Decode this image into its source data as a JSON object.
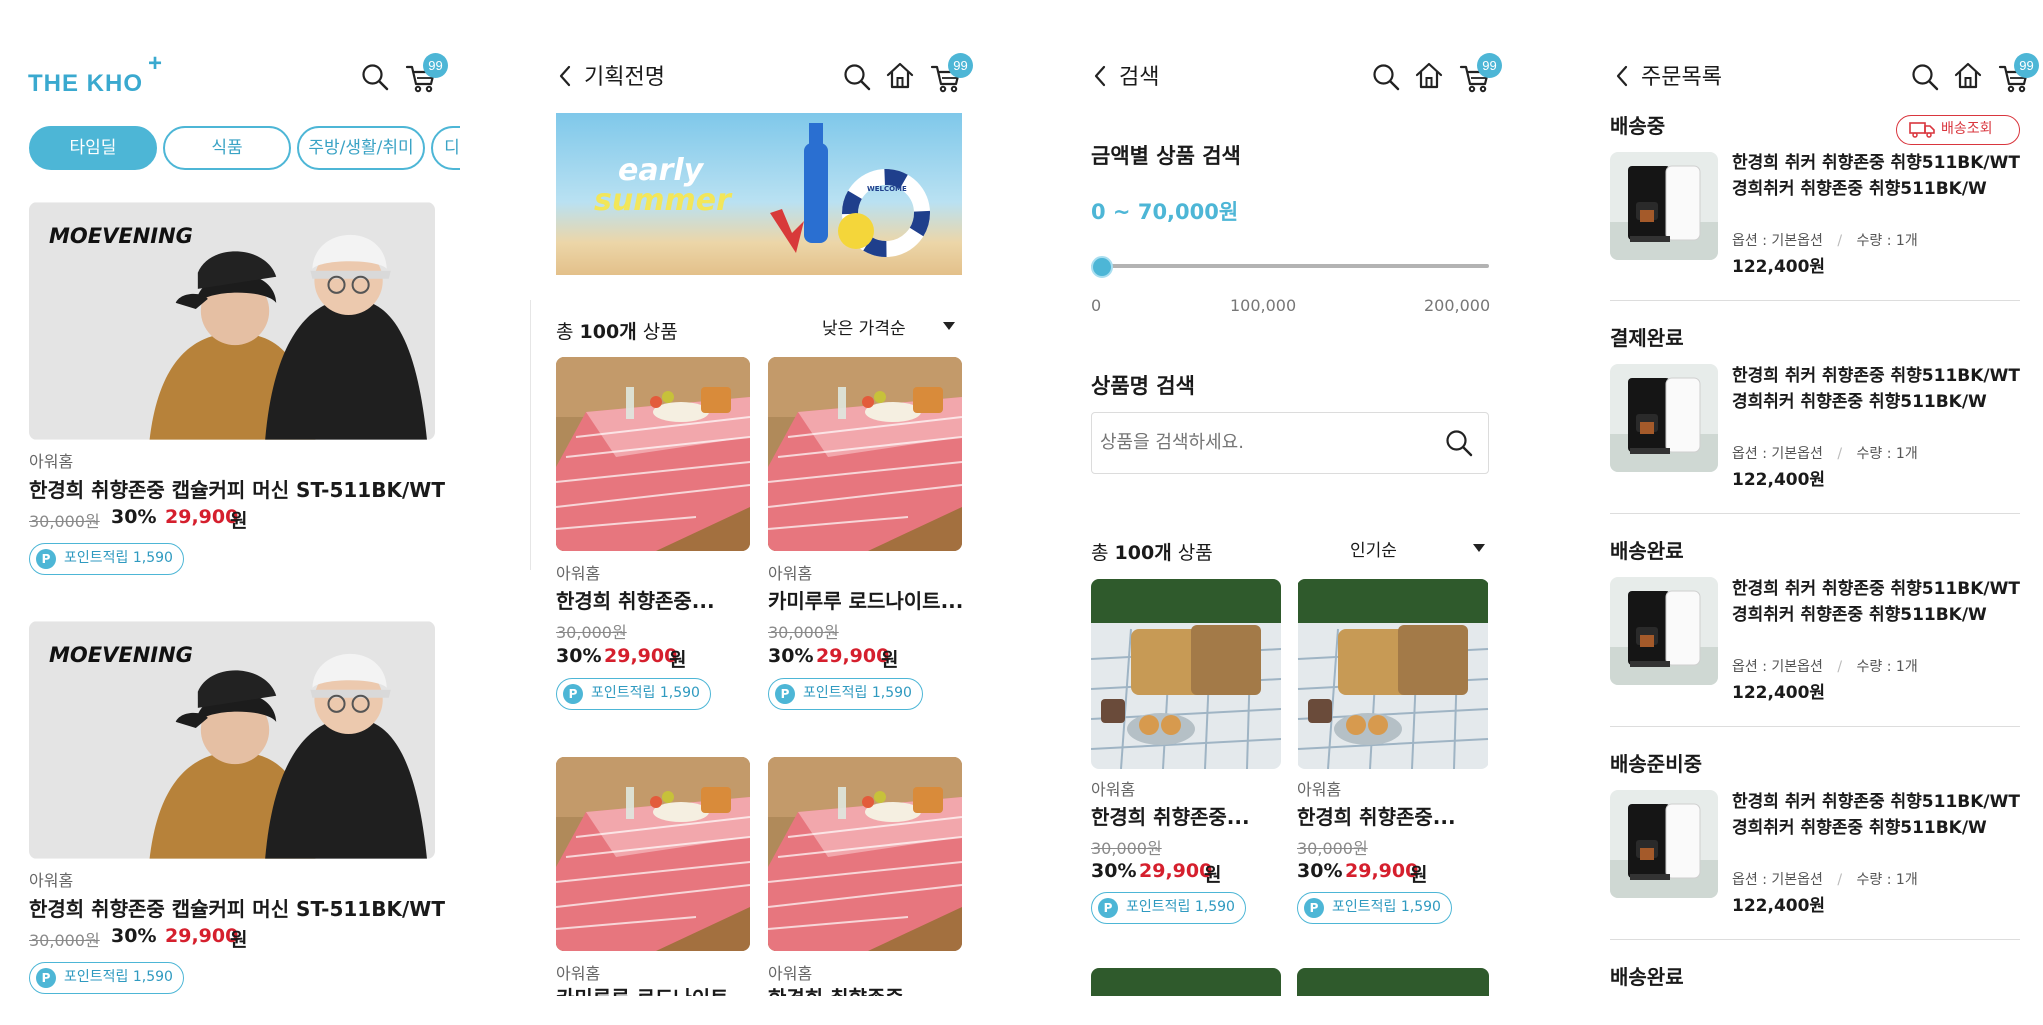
{
  "screen1": {
    "logo_text": "THE KHO",
    "logo_plus": "+",
    "cart_count": "99",
    "chips": [
      "타임딜",
      "식품",
      "주방/생활/취미",
      "디"
    ],
    "products": [
      {
        "banner_brand": "MOEVENING",
        "brand": "아워홈",
        "name": "한경희 취향존중 캡슐커피 머신 ST-511BK/WT",
        "original_price": "30,000원",
        "discount": "30%",
        "price": "29,900",
        "won": "원",
        "points": "포인트적립 1,590"
      },
      {
        "banner_brand": "MOEVENING",
        "brand": "아워홈",
        "name": "한경희 취향존중 캡슐커피 머신 ST-511BK/WT",
        "original_price": "30,000원",
        "discount": "30%",
        "price": "29,900",
        "won": "원",
        "points": "포인트적립 1,590"
      }
    ]
  },
  "screen2": {
    "title": "기획전명",
    "cart_count": "99",
    "banner_line1": "early",
    "banner_line2": "summer",
    "banner_ring_text": "WELCOME",
    "total_prefix": "총 ",
    "total_count": "100개",
    "total_suffix": " 상품",
    "sort": "낮은 가격순",
    "products": [
      {
        "brand": "아워홈",
        "name": "한경희 취향존중...",
        "original_price": "30,000원",
        "discount": "30%",
        "price": "29,900",
        "won": "원",
        "points": "포인트적립 1,590"
      },
      {
        "brand": "아워홈",
        "name": "카미루루 로드나이트...",
        "original_price": "30,000원",
        "discount": "30%",
        "price": "29,900",
        "won": "원",
        "points": "포인트적립 1,590"
      },
      {
        "brand": "아워홈",
        "name": "카미루루 로드나이트"
      },
      {
        "brand": "아워홈",
        "name": "한경희 취향존중"
      }
    ]
  },
  "screen3": {
    "title": "검색",
    "cart_count": "99",
    "price_section_title": "금액별 상품 검색",
    "price_range": "0 ~ 70,000원",
    "slider": {
      "min_value": 0,
      "max_value": 200000,
      "selected_max": 0,
      "ticks": [
        "0",
        "100,000",
        "200,000"
      ]
    },
    "name_section_title": "상품명 검색",
    "search_placeholder": "상품을 검색하세요.",
    "total_prefix": "총 ",
    "total_count": "100개",
    "total_suffix": " 상품",
    "sort": "인기순",
    "products": [
      {
        "brand": "아워홈",
        "name": "한경희 취향존중...",
        "original_price": "30,000원",
        "discount": "30%",
        "price": "29,900",
        "won": "원",
        "points": "포인트적립 1,590"
      },
      {
        "brand": "아워홈",
        "name": "한경희 취향존중...",
        "original_price": "30,000원",
        "discount": "30%",
        "price": "29,900",
        "won": "원",
        "points": "포인트적립 1,590"
      }
    ]
  },
  "screen4": {
    "title": "주문목록",
    "cart_count": "99",
    "track_button": "배송조회",
    "orders": [
      {
        "status": "배송중",
        "name": "한경희 취커 취향존중 취향511BK/WT경희취커 취향존중 취향511BK/W",
        "option": "옵션 : 기본옵션",
        "slash": "/",
        "qty": "수량 : 1개",
        "price": "122,400원"
      },
      {
        "status": "결제완료",
        "name": "한경희 취커 취향존중 취향511BK/WT경희취커 취향존중 취향511BK/W",
        "option": "옵션 : 기본옵션",
        "slash": "/",
        "qty": "수량 : 1개",
        "price": "122,400원"
      },
      {
        "status": "배송완료",
        "name": "한경희 취커 취향존중 취향511BK/WT경희취커 취향존중 취향511BK/W",
        "option": "옵션 : 기본옵션",
        "slash": "/",
        "qty": "수량 : 1개",
        "price": "122,400원"
      },
      {
        "status": "배송준비중",
        "name": "한경희 취커 취향존중 취향511BK/WT경희취커 취향존중 취향511BK/W",
        "option": "옵션 : 기본옵션",
        "slash": "/",
        "qty": "수량 : 1개",
        "price": "122,400원"
      },
      {
        "status": "배송완료"
      }
    ]
  },
  "colors": {
    "accent": "#4db6d6",
    "sale_red": "#d51f2d",
    "track_red": "#d9363e"
  }
}
